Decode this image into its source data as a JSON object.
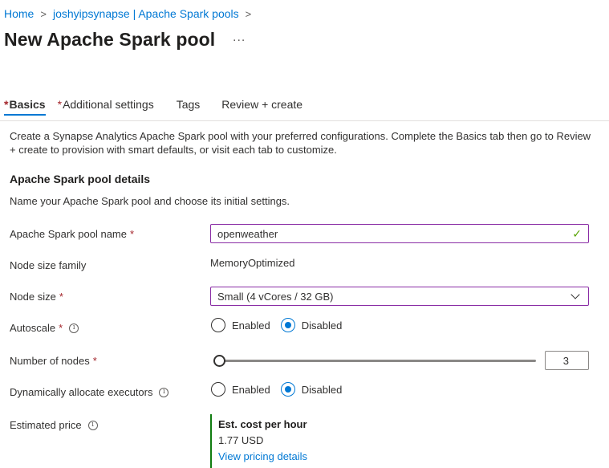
{
  "breadcrumb": {
    "items": [
      "Home",
      "joshyipsynapse | Apache Spark pools"
    ],
    "separator": ">"
  },
  "page": {
    "title": "New Apache Spark pool",
    "more": "..."
  },
  "tabs": [
    {
      "label": "Basics",
      "required": true,
      "active": true
    },
    {
      "label": "Additional settings",
      "required": true,
      "active": false
    },
    {
      "label": "Tags",
      "required": false,
      "active": false
    },
    {
      "label": "Review + create",
      "required": false,
      "active": false
    }
  ],
  "required_marker": "*",
  "intro": "Create a Synapse Analytics Apache Spark pool with your preferred configurations. Complete the Basics tab then go to Review + create to provision with smart defaults, or visit each tab to customize.",
  "section": {
    "title": "Apache Spark pool details",
    "subtitle": "Name your Apache Spark pool and choose its initial settings."
  },
  "form": {
    "pool_name": {
      "label": "Apache Spark pool name",
      "value": "openweather",
      "valid": true
    },
    "node_size_family": {
      "label": "Node size family",
      "value": "MemoryOptimized"
    },
    "node_size": {
      "label": "Node size",
      "value": "Small (4 vCores / 32 GB)"
    },
    "autoscale": {
      "label": "Autoscale",
      "options": [
        "Enabled",
        "Disabled"
      ],
      "selected": "Disabled"
    },
    "number_of_nodes": {
      "label": "Number of nodes",
      "value": "3",
      "slider_fraction": 0.0
    },
    "dynamic_executors": {
      "label": "Dynamically allocate executors",
      "options": [
        "Enabled",
        "Disabled"
      ],
      "selected": "Disabled"
    },
    "estimated_price": {
      "label": "Estimated price",
      "title": "Est. cost per hour",
      "value": "1.77 USD",
      "link": "View pricing details"
    }
  },
  "icons": {
    "info": "info-icon",
    "check": "checkmark-icon",
    "chevron": "chevron-down-icon",
    "breadcrumb_sep": "chevron-right-icon"
  },
  "colors": {
    "accent": "#0078d4",
    "required": "#a4262c",
    "valid": "#57a300",
    "focus_border": "#8a2da5",
    "price_bar": "#107c10"
  }
}
